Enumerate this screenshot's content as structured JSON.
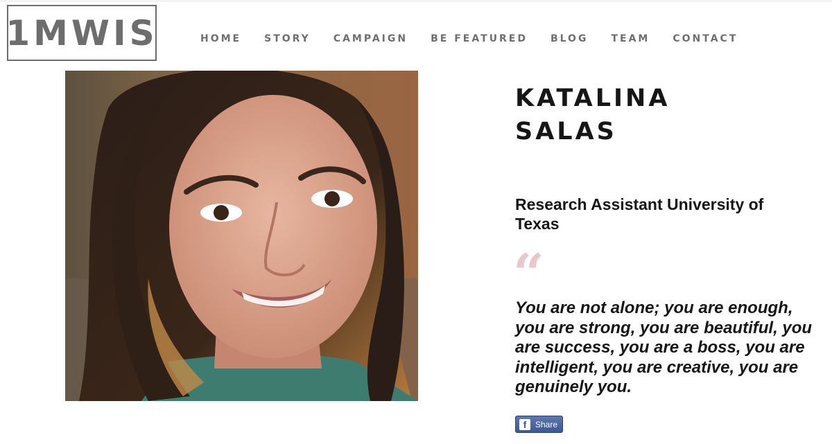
{
  "brand": {
    "logo_text": "1MWIS"
  },
  "nav": {
    "items": [
      {
        "label": "HOME"
      },
      {
        "label": "STORY"
      },
      {
        "label": "CAMPAIGN"
      },
      {
        "label": "BE FEATURED"
      },
      {
        "label": "BLOG"
      },
      {
        "label": "TEAM"
      },
      {
        "label": "CONTACT"
      }
    ]
  },
  "profile": {
    "first_name": "KATALINA",
    "last_name": "SALAS",
    "role": "Research Assistant University of Texas",
    "quote_mark": "“",
    "quote": "You are not alone; you are enough, you are strong, you are beautiful, you are success, you are a boss, you are intelligent, you are creative, you are genuinely you."
  },
  "share": {
    "icon": "facebook-icon",
    "label": "Share"
  },
  "colors": {
    "nav": "#6f6f6f",
    "quote_mark": "#e9c8cc",
    "facebook": "#3b5998"
  }
}
